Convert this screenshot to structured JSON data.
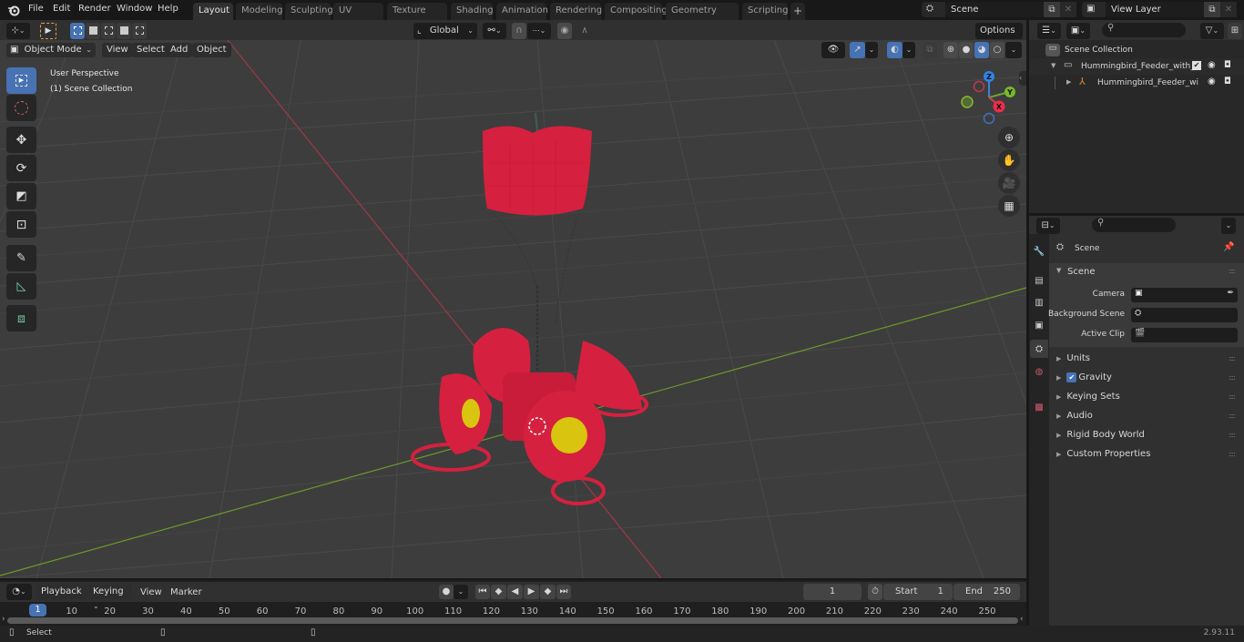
{
  "app": {
    "version": "2.93.11"
  },
  "menu": [
    "File",
    "Edit",
    "Render",
    "Window",
    "Help"
  ],
  "workspaces": [
    {
      "label": "Layout",
      "active": true
    },
    {
      "label": "Modeling"
    },
    {
      "label": "Sculpting"
    },
    {
      "label": "UV Editing"
    },
    {
      "label": "Texture Paint"
    },
    {
      "label": "Shading"
    },
    {
      "label": "Animation"
    },
    {
      "label": "Rendering"
    },
    {
      "label": "Compositing"
    },
    {
      "label": "Geometry Nodes"
    },
    {
      "label": "Scripting"
    }
  ],
  "add_workspace": "+",
  "scene_selector": {
    "value": "Scene"
  },
  "view_layer_selector": {
    "value": "View Layer"
  },
  "tool_header": {
    "transform_orientation": "Global",
    "options": "Options"
  },
  "viewport_header": {
    "mode": "Object Mode",
    "menus": [
      "View",
      "Select",
      "Add",
      "Object"
    ]
  },
  "viewport": {
    "overlay_text": [
      "User Perspective",
      "(1) Scene Collection"
    ],
    "gizmo_axes": [
      "X",
      "Y",
      "Z"
    ],
    "colors": {
      "object": "#d6203f",
      "accent_yellow": "#d9c410",
      "x_axis": "#9e3a46",
      "y_axis": "#6d9a2a",
      "background": "#3d3d3d"
    }
  },
  "toolbar": [
    {
      "name": "select-box",
      "active": true
    },
    {
      "name": "cursor"
    },
    {
      "name": "move"
    },
    {
      "name": "rotate"
    },
    {
      "name": "scale"
    },
    {
      "name": "transform"
    },
    {
      "name": "annotate"
    },
    {
      "name": "measure"
    },
    {
      "name": "add-cube"
    }
  ],
  "outliner": {
    "search_placeholder": "",
    "root": "Scene Collection",
    "items": [
      {
        "label": "Hummingbird_Feeder_with_R",
        "type": "collection",
        "checked": true
      },
      {
        "label": "Hummingbird_Feeder_wi",
        "type": "empty"
      }
    ]
  },
  "properties": {
    "search_placeholder": "",
    "context": "Scene",
    "panel_title": "Scene",
    "fields": [
      {
        "label": "Camera",
        "value": ""
      },
      {
        "label": "Background Scene",
        "value": ""
      },
      {
        "label": "Active Clip",
        "value": ""
      }
    ],
    "subpanels": [
      {
        "label": "Units"
      },
      {
        "label": "Gravity",
        "checkbox": true,
        "checked": true
      },
      {
        "label": "Keying Sets"
      },
      {
        "label": "Audio"
      },
      {
        "label": "Rigid Body World"
      },
      {
        "label": "Custom Properties"
      }
    ]
  },
  "timeline": {
    "menus": [
      "Playback",
      "Keying",
      "View",
      "Marker"
    ],
    "current_frame": "1",
    "start_label": "Start",
    "start": "1",
    "end_label": "End",
    "end": "250",
    "ticks": [
      "10",
      "20",
      "30",
      "40",
      "50",
      "60",
      "70",
      "80",
      "90",
      "100",
      "110",
      "120",
      "130",
      "140",
      "150",
      "160",
      "170",
      "180",
      "190",
      "200",
      "210",
      "220",
      "230",
      "240",
      "250"
    ],
    "playhead": "1"
  },
  "statusbar": {
    "left": "Select",
    "version": "2.93.11"
  }
}
